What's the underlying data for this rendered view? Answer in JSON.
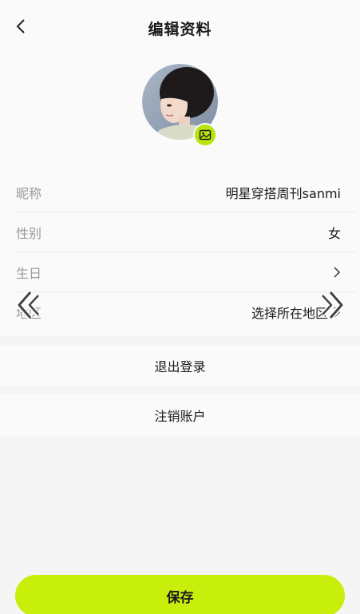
{
  "header": {
    "title": "编辑资料"
  },
  "profile": {
    "avatar_icon": "person-photo",
    "edit_icon": "image-icon",
    "accent_color": "#c8ee0c"
  },
  "form": {
    "nickname": {
      "label": "昵称",
      "value": "明星穿搭周刊sanmi"
    },
    "gender": {
      "label": "性别",
      "value": "女"
    },
    "birthday": {
      "label": "生日",
      "value": ""
    },
    "region": {
      "label": "地区",
      "value": "选择所在地区"
    }
  },
  "actions": {
    "logout_label": "退出登录",
    "delete_account_label": "注销账户",
    "save_label": "保存"
  }
}
